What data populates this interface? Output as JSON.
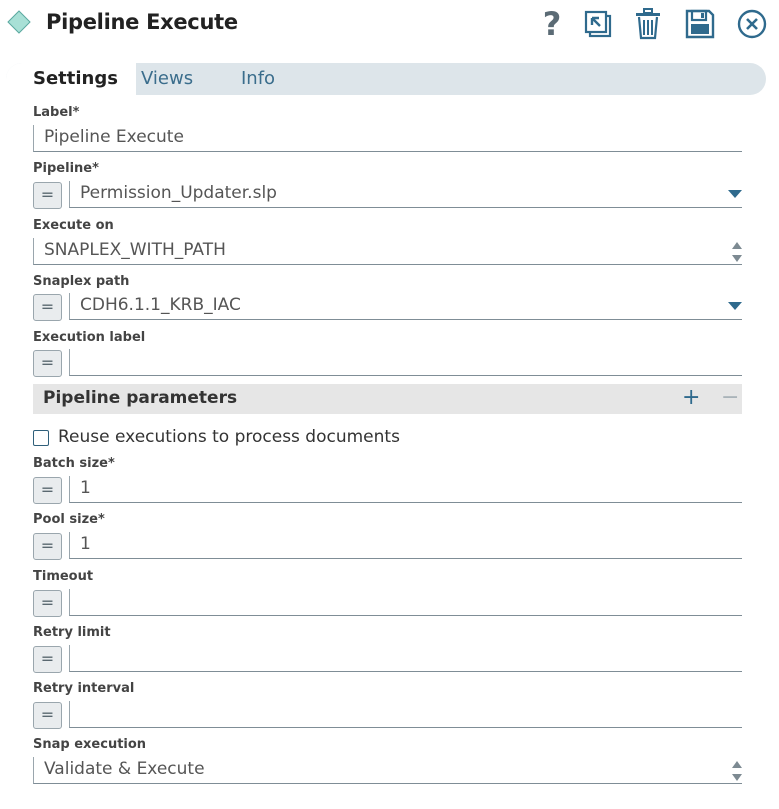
{
  "header": {
    "title": "Pipeline Execute"
  },
  "tabs": {
    "settings": "Settings",
    "views": "Views",
    "info": "Info"
  },
  "fields": {
    "label": {
      "label": "Label*",
      "value": "Pipeline Execute"
    },
    "pipeline": {
      "label": "Pipeline*",
      "value": "Permission_Updater.slp"
    },
    "execute_on": {
      "label": "Execute on",
      "value": "SNAPLEX_WITH_PATH"
    },
    "snaplex_path": {
      "label": "Snaplex path",
      "value": "CDH6.1.1_KRB_IAC"
    },
    "execution_label": {
      "label": "Execution label",
      "value": ""
    },
    "pipeline_parameters": {
      "title": "Pipeline parameters",
      "add": "+",
      "remove": "−"
    },
    "reuse": {
      "label": "Reuse executions to process documents",
      "checked": false
    },
    "batch_size": {
      "label": "Batch size*",
      "value": "1"
    },
    "pool_size": {
      "label": "Pool size*",
      "value": "1"
    },
    "timeout": {
      "label": "Timeout",
      "value": ""
    },
    "retry_limit": {
      "label": "Retry limit",
      "value": ""
    },
    "retry_interval": {
      "label": "Retry interval",
      "value": ""
    },
    "snap_execution": {
      "label": "Snap execution",
      "value": "Validate & Execute"
    }
  },
  "expression_toggle": "=",
  "icons": {
    "snap": "diamond-icon",
    "help": "question-mark-icon",
    "export": "export-icon",
    "delete": "trash-icon",
    "save": "floppy-disk-icon",
    "close": "close-circle-icon"
  },
  "colors": {
    "accent": "#2f6a8d",
    "tab_bar": "#dde5ea",
    "diamond": "#9fd9d0"
  }
}
